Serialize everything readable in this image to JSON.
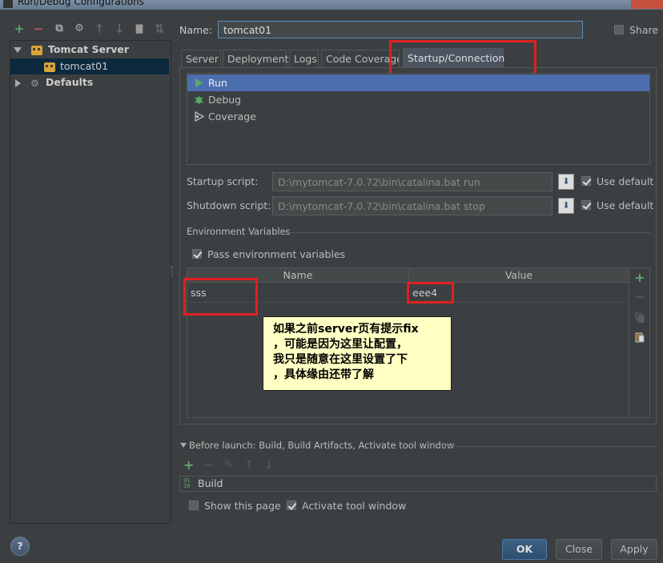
{
  "window": {
    "title": "Run/Debug Configurations"
  },
  "toolbar": {
    "add": "+",
    "remove": "−",
    "copy": "⧉",
    "settings": "⚙",
    "up": "↑",
    "down": "↓",
    "folder": "▇",
    "sort": "⇅"
  },
  "tree": {
    "group_label": "Tomcat Server",
    "child_label": "tomcat01",
    "defaults_label": "Defaults"
  },
  "name_field": {
    "label": "Name:",
    "value": "tomcat01"
  },
  "share": {
    "label": "Share"
  },
  "tabs": [
    {
      "label": "Server"
    },
    {
      "label": "Deployment"
    },
    {
      "label": "Logs"
    },
    {
      "label": "Code Coverage"
    },
    {
      "label": "Startup/Connection"
    }
  ],
  "modes": [
    {
      "label": "Run"
    },
    {
      "label": "Debug"
    },
    {
      "label": "Coverage"
    }
  ],
  "startup": {
    "label": "Startup script:",
    "value": "D:\\mytomcat-7.0.72\\bin\\catalina.bat run",
    "use_default": "Use default"
  },
  "shutdown": {
    "label": "Shutdown script:",
    "value": "D:\\mytomcat-7.0.72\\bin\\catalina.bat stop",
    "use_default": "Use default"
  },
  "env": {
    "section_label": "Environment Variables",
    "pass_label": "Pass environment variables",
    "columns": [
      "Name",
      "Value"
    ],
    "rows": [
      {
        "name": "sss",
        "value": "eee4"
      }
    ]
  },
  "annotation": {
    "lines": [
      "如果之前server页有提示fix",
      "，可能是因为这里让配置，",
      "我只是随意在这里设置了下",
      "，具体缘由还带了解"
    ]
  },
  "before_launch": {
    "label": "Before launch: Build, Build Artifacts, Activate tool window",
    "items": [
      "Build"
    ],
    "show_page": "Show this page",
    "activate_tool": "Activate tool window"
  },
  "buttons": {
    "ok": "OK",
    "close": "Close",
    "apply": "Apply",
    "help": "?"
  },
  "colors": {
    "accent": "#4b6eaf",
    "highlight": "#e02020",
    "note_bg": "#ffffc4"
  }
}
